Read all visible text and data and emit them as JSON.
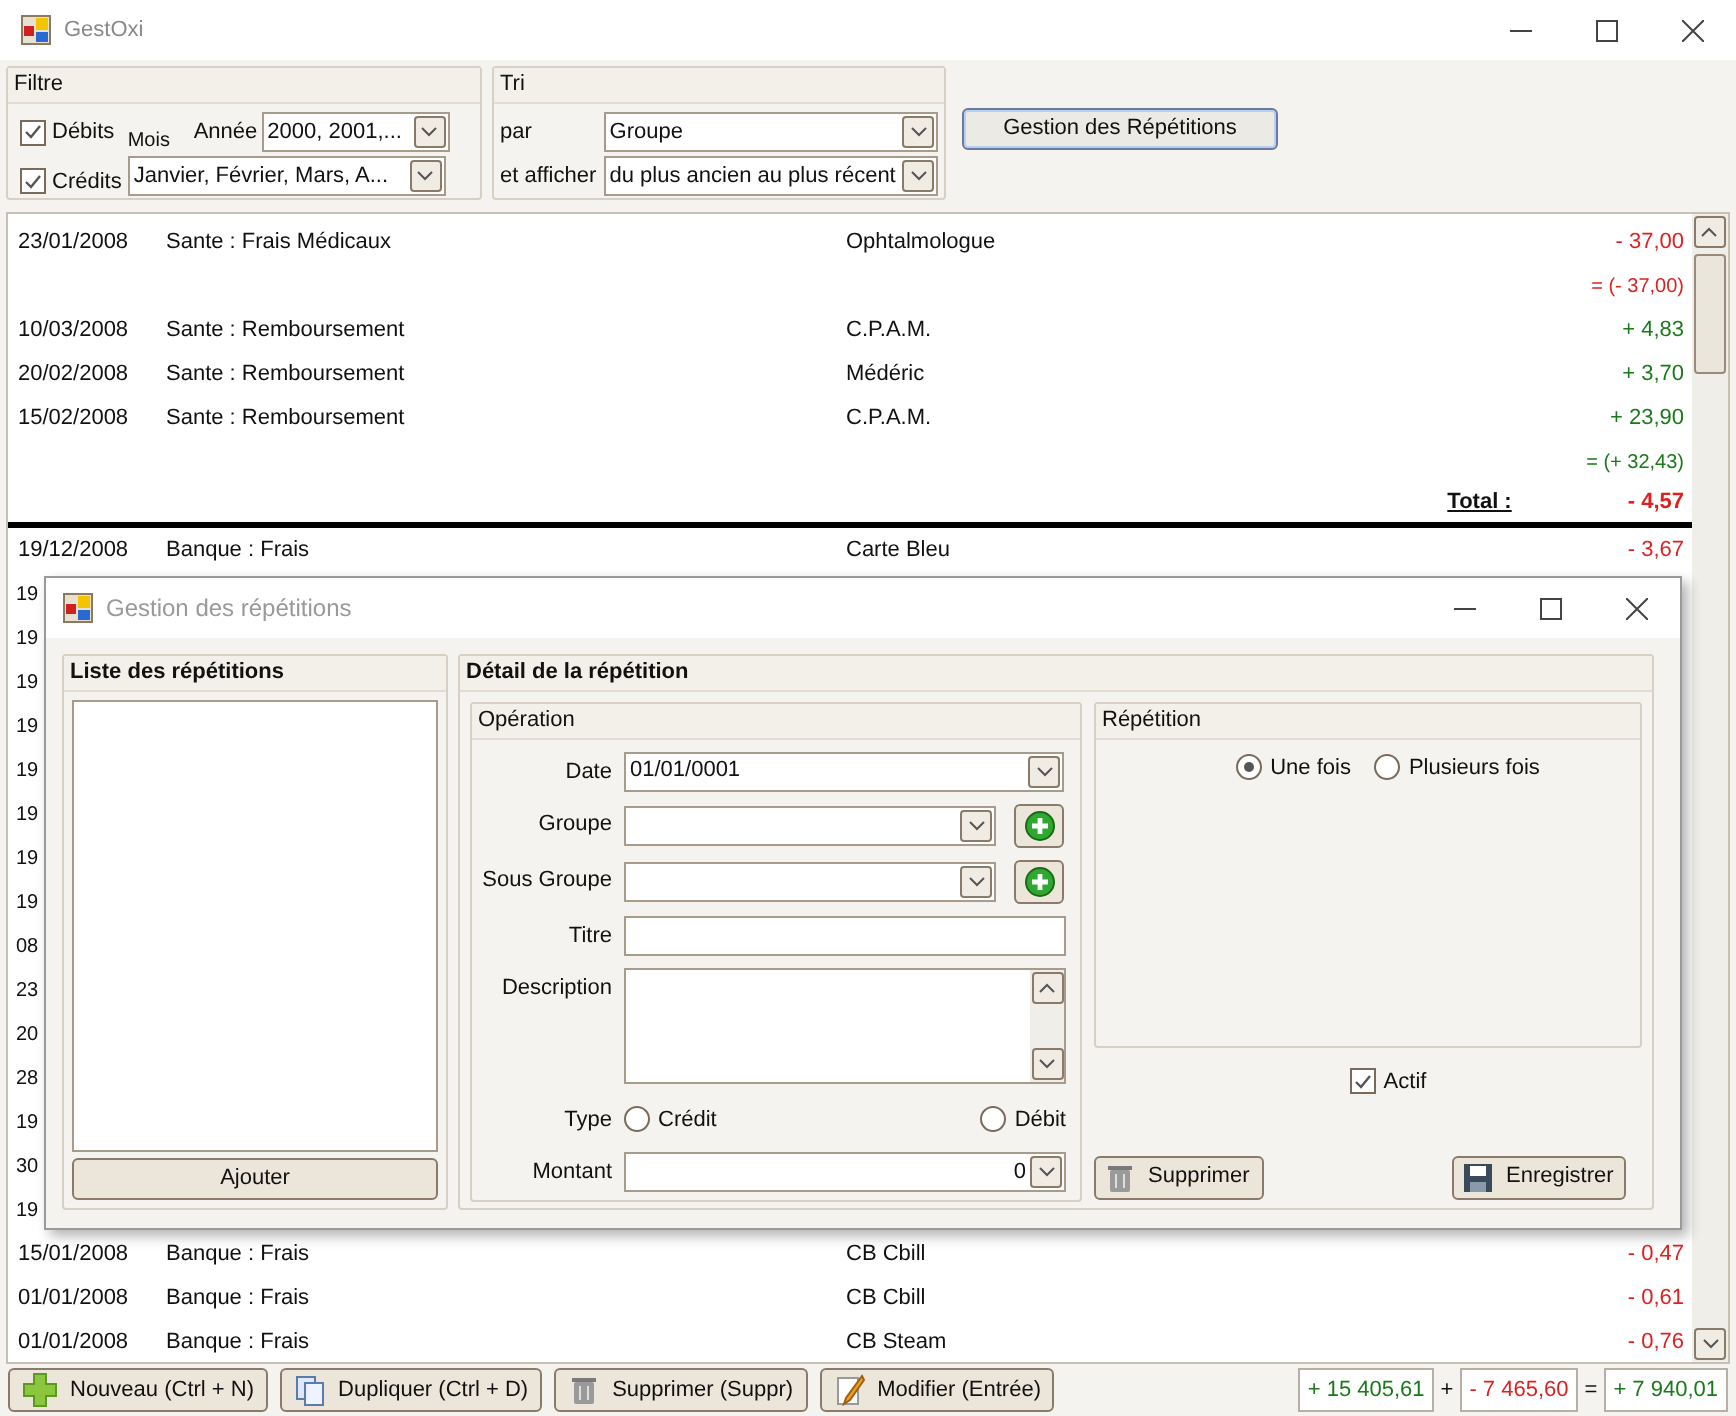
{
  "window": {
    "title": "GestOxi"
  },
  "filter": {
    "title": "Filtre",
    "checks": [
      {
        "label": "Débits",
        "checked": true
      },
      {
        "label": "Crédits",
        "checked": true
      }
    ],
    "month_label": "Mois",
    "year_label": "Année",
    "year_value": "2000, 2001,...",
    "month_value": "Janvier, Février, Mars, A..."
  },
  "sort": {
    "title": "Tri",
    "by_label": "par",
    "by_value": "Groupe",
    "order_label": "et afficher",
    "order_value": "du plus ancien au plus récent"
  },
  "repetitions_button": "Gestion des Répétitions",
  "rows": [
    {
      "kind": "entry",
      "date": "23/01/2008",
      "category": "Sante : Frais Médicaux",
      "payee": "Ophtalmologue",
      "amount": "- 37,00",
      "color": "#e02020"
    },
    {
      "kind": "subtotal",
      "amount": "= (- 37,00)",
      "color": "#e02020"
    },
    {
      "kind": "entry",
      "date": "10/03/2008",
      "category": "Sante : Remboursement",
      "payee": "C.P.A.M.",
      "amount": "+ 4,83",
      "color": "#1a7a1a"
    },
    {
      "kind": "entry",
      "date": "20/02/2008",
      "category": "Sante : Remboursement",
      "payee": "Médéric",
      "amount": "+ 3,70",
      "color": "#1a7a1a"
    },
    {
      "kind": "entry",
      "date": "15/02/2008",
      "category": "Sante : Remboursement",
      "payee": "C.P.A.M.",
      "amount": "+ 23,90",
      "color": "#1a7a1a"
    },
    {
      "kind": "subtotal",
      "amount": "= (+ 32,43)",
      "color": "#1a7a1a"
    },
    {
      "kind": "total",
      "label": "Total :",
      "amount": "- 4,57",
      "color": "#e02020"
    },
    {
      "kind": "entry",
      "date": "19/12/2008",
      "category": "Banque : Frais",
      "payee": "Carte Bleu",
      "amount": "- 3,67",
      "color": "#e02020"
    },
    {
      "kind": "covered",
      "date": "19"
    },
    {
      "kind": "covered",
      "date": "19"
    },
    {
      "kind": "covered",
      "date": "19"
    },
    {
      "kind": "covered",
      "date": "19"
    },
    {
      "kind": "covered",
      "date": "19"
    },
    {
      "kind": "covered",
      "date": "19"
    },
    {
      "kind": "covered",
      "date": "19"
    },
    {
      "kind": "covered",
      "date": "19"
    },
    {
      "kind": "covered",
      "date": "08"
    },
    {
      "kind": "covered",
      "date": "23"
    },
    {
      "kind": "covered",
      "date": "20"
    },
    {
      "kind": "covered",
      "date": "28"
    },
    {
      "kind": "covered",
      "date": "19"
    },
    {
      "kind": "covered",
      "date": "30"
    },
    {
      "kind": "covered",
      "date": "19"
    },
    {
      "kind": "entry",
      "date": "15/01/2008",
      "category": "Banque : Frais",
      "payee": "CB Cbill",
      "amount": "- 0,47",
      "color": "#e02020"
    },
    {
      "kind": "entry",
      "date": "01/01/2008",
      "category": "Banque : Frais",
      "payee": "CB Cbill",
      "amount": "- 0,61",
      "color": "#e02020"
    },
    {
      "kind": "entry",
      "date": "01/01/2008",
      "category": "Banque : Frais",
      "payee": "CB Steam",
      "amount": "- 0,76",
      "color": "#e02020"
    }
  ],
  "toolbar": {
    "buttons": [
      {
        "kind": "add",
        "label": "Nouveau (Ctrl + N)"
      },
      {
        "kind": "copy",
        "label": "Dupliquer (Ctrl + D)"
      },
      {
        "kind": "delete",
        "label": "Supprimer (Suppr)"
      },
      {
        "kind": "edit",
        "label": "Modifier (Entrée)"
      }
    ],
    "totals": [
      {
        "kind": "value",
        "text": "+ 15 405,61",
        "color": "#1a7a1a"
      },
      {
        "kind": "operator",
        "text": "+"
      },
      {
        "kind": "value",
        "text": "- 7 465,60",
        "color": "#e02020"
      },
      {
        "kind": "operator",
        "text": "="
      },
      {
        "kind": "value",
        "text": "+ 7 940,01",
        "color": "#1a7a1a"
      }
    ]
  },
  "dialog": {
    "title": "Gestion des répétitions",
    "list_title": "Liste des répétitions",
    "add_button": "Ajouter",
    "detail_title": "Détail de la répétition",
    "operation": {
      "title": "Opération",
      "fields": [
        {
          "kind": "dropdown",
          "label": "Date",
          "value": "01/01/0001"
        },
        {
          "kind": "dropdown_add",
          "label": "Groupe"
        },
        {
          "kind": "dropdown_add",
          "label": "Sous Groupe"
        },
        {
          "kind": "text",
          "label": "Titre"
        },
        {
          "kind": "multiline",
          "label": "Description"
        }
      ],
      "type_label": "Type",
      "types": [
        {
          "label": "Crédit",
          "selected": false
        },
        {
          "label": "Débit",
          "selected": false
        }
      ],
      "amount_label": "Montant",
      "amount_value": "0"
    },
    "repetition": {
      "title": "Répétition",
      "options": [
        {
          "label": "Une fois",
          "selected": true
        },
        {
          "label": "Plusieurs fois",
          "selected": false
        }
      ]
    },
    "active": {
      "label": "Actif",
      "checked": true
    },
    "delete_button": "Supprimer",
    "save_button": "Enregistrer"
  }
}
